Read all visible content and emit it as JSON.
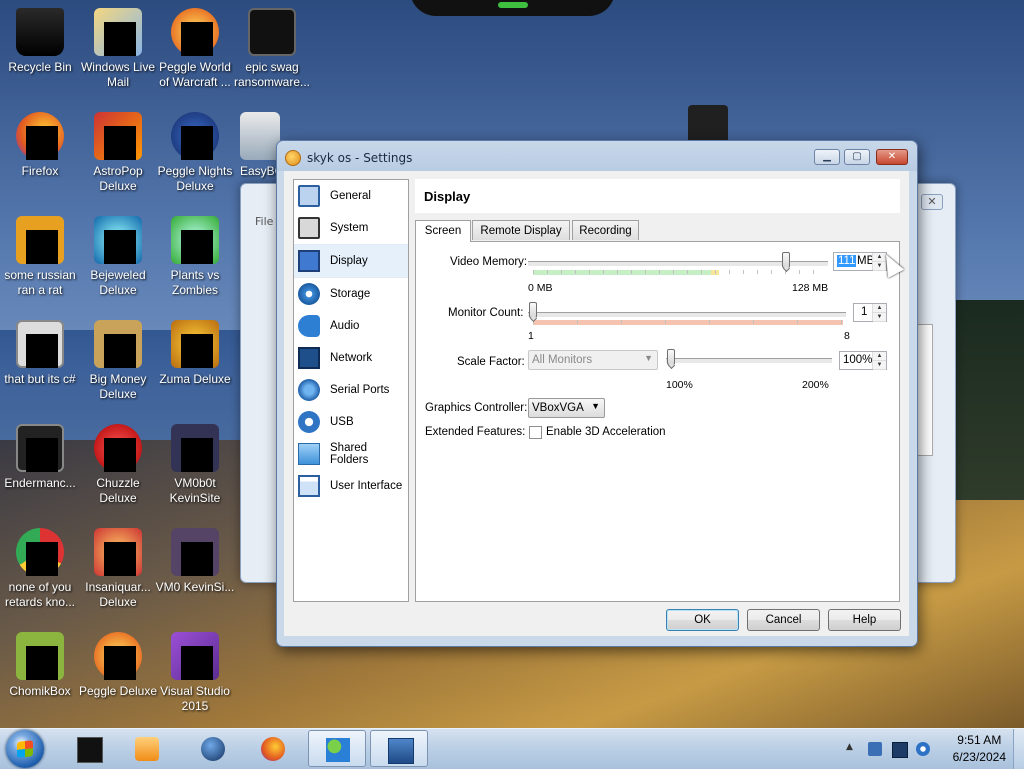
{
  "desktop_icons": [
    {
      "label": "Recycle Bin",
      "icon": "recycle-bin-icon"
    },
    {
      "label": "Windows Live Mail",
      "icon": "windows-live-mail-icon"
    },
    {
      "label": "Peggle World of Warcraft ...",
      "icon": "peggle-icon"
    },
    {
      "label": "epic swag ransomware...",
      "icon": "terminal-icon"
    },
    {
      "label": "Firefox",
      "icon": "firefox-icon"
    },
    {
      "label": "AstroPop Deluxe",
      "icon": "astropop-icon"
    },
    {
      "label": "Peggle Nights Deluxe",
      "icon": "peggle-nights-icon"
    },
    {
      "label": "EasyBC",
      "icon": "easybcd-icon"
    },
    {
      "label": "some russian ran a rat",
      "icon": "rat-icon"
    },
    {
      "label": "Bejeweled Deluxe",
      "icon": "bejeweled-icon"
    },
    {
      "label": "Plants vs Zombies",
      "icon": "pvz-icon"
    },
    {
      "label": "that but its c#",
      "icon": "copy-icon"
    },
    {
      "label": "Big Money Deluxe",
      "icon": "big-money-icon"
    },
    {
      "label": "Zuma Deluxe",
      "icon": "zuma-icon"
    },
    {
      "label": "Endermanc...",
      "icon": "endermanch-icon"
    },
    {
      "label": "Chuzzle Deluxe",
      "icon": "chuzzle-icon"
    },
    {
      "label": "VM0b0t KevinSite",
      "icon": "vm-icon"
    },
    {
      "label": "none of you retards kno...",
      "icon": "chrome-icon"
    },
    {
      "label": "Insaniquar... Deluxe",
      "icon": "insaniquarium-icon"
    },
    {
      "label": "VM0 KevinSi...",
      "icon": "vm2-icon"
    },
    {
      "label": "ChomikBox",
      "icon": "chomikbox-icon"
    },
    {
      "label": "Peggle Deluxe",
      "icon": "peggle-deluxe-icon"
    },
    {
      "label": "Visual Studio 2015",
      "icon": "visual-studio-icon"
    }
  ],
  "background_window": {
    "menu_label": "File",
    "close_glyph": "✕"
  },
  "dialog": {
    "title": "skyk os - Settings",
    "buttons": {
      "minimize": "▁",
      "maximize": "▢",
      "close": "✕"
    }
  },
  "nav": [
    {
      "label": "General",
      "icon": "general-icon"
    },
    {
      "label": "System",
      "icon": "system-icon"
    },
    {
      "label": "Display",
      "icon": "display-icon",
      "selected": true
    },
    {
      "label": "Storage",
      "icon": "storage-icon"
    },
    {
      "label": "Audio",
      "icon": "audio-icon"
    },
    {
      "label": "Network",
      "icon": "network-icon"
    },
    {
      "label": "Serial Ports",
      "icon": "serial-ports-icon"
    },
    {
      "label": "USB",
      "icon": "usb-icon"
    },
    {
      "label": "Shared Folders",
      "icon": "shared-folders-icon"
    },
    {
      "label": "User Interface",
      "icon": "user-interface-icon"
    }
  ],
  "page": {
    "title": "Display",
    "tabs": [
      "Screen",
      "Remote Display",
      "Recording"
    ],
    "active_tab": "Screen",
    "video_memory": {
      "label": "Video Memory:",
      "value": "111",
      "unit": "MB",
      "min_label": "0 MB",
      "max_label": "128 MB",
      "fraction": 0.867
    },
    "monitor_count": {
      "label": "Monitor Count:",
      "value": "1",
      "min_label": "1",
      "max_label": "8",
      "fraction": 0.0
    },
    "scale_factor": {
      "label": "Scale Factor:",
      "combo_value": "All Monitors",
      "value": "100%",
      "min_label": "100%",
      "max_label": "200%",
      "fraction": 0.0
    },
    "graphics_controller": {
      "label": "Graphics Controller:",
      "value": "VBoxVGA"
    },
    "extended_features": {
      "label": "Extended Features:",
      "checkbox_label": "Enable 3D Acceleration",
      "checked": false
    }
  },
  "footer_buttons": {
    "ok": "OK",
    "cancel": "Cancel",
    "help": "Help"
  },
  "taskbar": {
    "items": [
      "media-player-icon",
      "black-box-icon",
      "earth-icon",
      "firefox-icon",
      "people-icon",
      "virtualbox-icon"
    ],
    "active_item": "virtualbox-icon",
    "time": "9:51 AM",
    "date": "6/23/2024",
    "tray_icons": [
      "show-hidden-icons-icon",
      "network-tray-icon",
      "display-tray-icon",
      "volume-tray-icon"
    ]
  }
}
